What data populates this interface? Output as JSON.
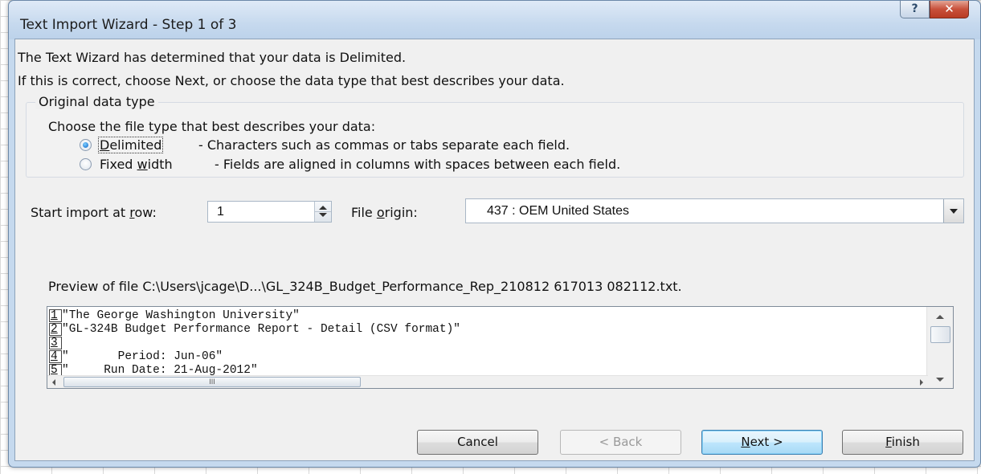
{
  "window": {
    "title": "Text Import Wizard - Step 1 of 3",
    "help_label": "?",
    "close_label": "✕"
  },
  "intro": {
    "line1": "The Text Wizard has determined that your data is Delimited.",
    "line2": "If this is correct, choose Next, or choose the data type that best describes your data."
  },
  "original_data_type": {
    "legend": "Original data type",
    "prompt": "Choose the file type that best describes your data:",
    "options": [
      {
        "label_pre": "",
        "label_mnemonic": "D",
        "label_post": "elimited",
        "description": "- Characters such as commas or tabs separate each field.",
        "selected": true
      },
      {
        "label_pre": "Fixed ",
        "label_mnemonic": "w",
        "label_post": "idth",
        "description": "- Fields are aligned in columns with spaces between each field.",
        "selected": false
      }
    ]
  },
  "start_row": {
    "label_pre": "Start import at ",
    "label_mnemonic": "r",
    "label_post": "ow:",
    "value": "1"
  },
  "file_origin": {
    "label_pre": "File ",
    "label_mnemonic": "o",
    "label_post": "rigin:",
    "value": "437 : OEM United States"
  },
  "preview": {
    "label": "Preview of file C:\\Users\\jcage\\D...\\GL_324B_Budget_Performance_Rep_210812 617013 082112.txt.",
    "lines": [
      {
        "num": "1",
        "text": "\"The George Washington University\""
      },
      {
        "num": "2",
        "text": "\"GL-324B Budget Performance Report - Detail (CSV format)\""
      },
      {
        "num": "3",
        "text": ""
      },
      {
        "num": "4",
        "text": "\"       Period: Jun-06\""
      },
      {
        "num": "5",
        "text": "\"     Run Date: 21-Aug-2012\""
      }
    ],
    "hscroll_grip": "III"
  },
  "buttons": {
    "cancel": "Cancel",
    "back": "< Back",
    "next_mnemonic": "N",
    "next_rest": "ext >",
    "finish_mnemonic": "F",
    "finish_rest": "inish"
  }
}
